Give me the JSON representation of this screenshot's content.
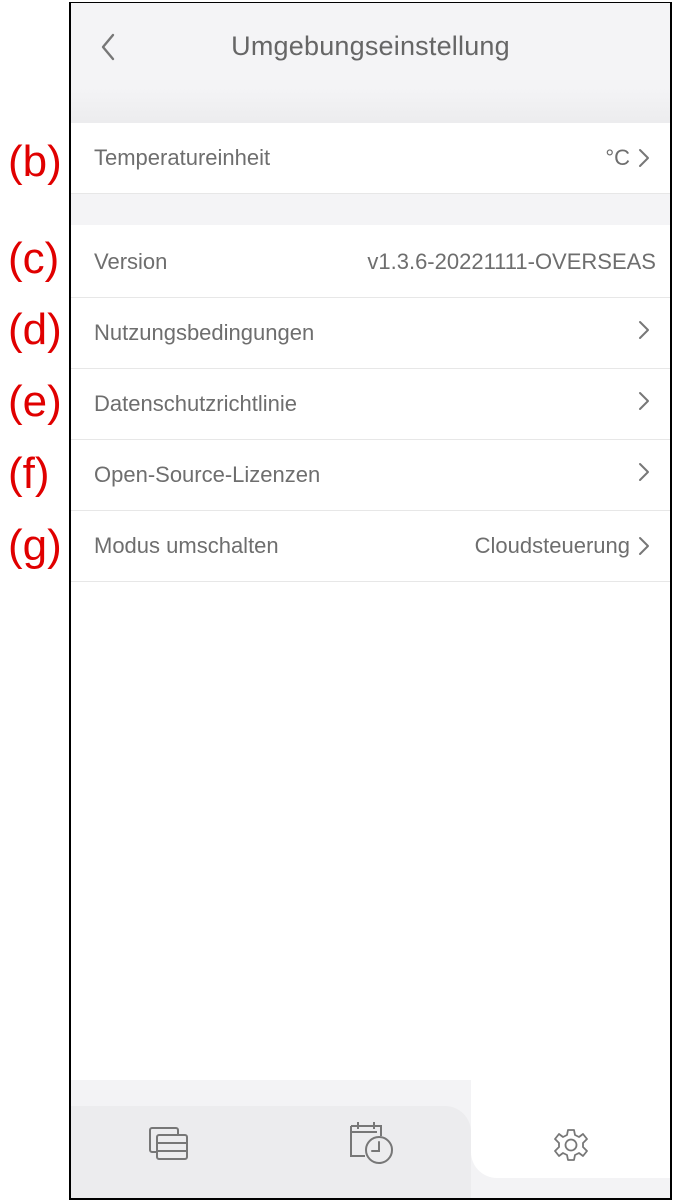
{
  "header": {
    "title": "Umgebungseinstellung",
    "back_icon": "chevron-left-icon"
  },
  "settings": {
    "temperature": {
      "label": "Temperatureinheit",
      "value": "°C"
    },
    "version": {
      "label": "Version",
      "value": "v1.3.6-20221111-OVERSEAS"
    },
    "terms": {
      "label": "Nutzungsbedingungen"
    },
    "privacy": {
      "label": "Datenschutzrichtlinie"
    },
    "licenses": {
      "label": "Open-Source-Lizenzen"
    },
    "mode": {
      "label": "Modus umschalten",
      "value": "Cloudsteuerung"
    }
  },
  "annotations": [
    "(b)",
    "(c)",
    "(d)",
    "(e)",
    "(f)",
    "(g)"
  ],
  "tabbar": {
    "tabs": [
      {
        "icon": "devices-icon",
        "active": false
      },
      {
        "icon": "schedule-icon",
        "active": false
      },
      {
        "icon": "gear-icon",
        "active": true
      }
    ]
  },
  "colors": {
    "annotation": "#e00000",
    "text": "#6e6e6e",
    "background_gray": "#f4f4f6"
  }
}
